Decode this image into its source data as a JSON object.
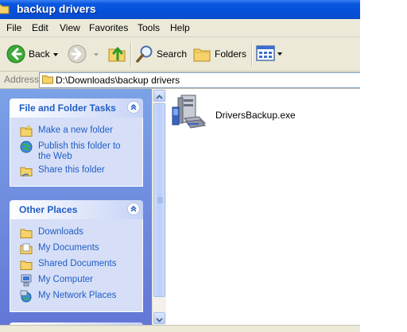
{
  "window": {
    "title": "backup drivers"
  },
  "menu": [
    "File",
    "Edit",
    "View",
    "Favorites",
    "Tools",
    "Help"
  ],
  "toolbar": {
    "back_label": "Back",
    "search_label": "Search",
    "folders_label": "Folders"
  },
  "address": {
    "label": "Address",
    "value": "D:\\Downloads\\backup drivers"
  },
  "tasks": {
    "title": "File and Folder Tasks",
    "items": [
      {
        "label": "Make a new folder",
        "icon": "new-folder-icon"
      },
      {
        "label": "Publish this folder to the Web",
        "line1": "Publish this folder to",
        "line2": "the Web",
        "icon": "globe-icon"
      },
      {
        "label": "Share this folder",
        "icon": "share-folder-icon"
      }
    ]
  },
  "places": {
    "title": "Other Places",
    "items": [
      {
        "label": "Downloads",
        "icon": "folder-icon"
      },
      {
        "label": "My Documents",
        "icon": "my-documents-icon"
      },
      {
        "label": "Shared Documents",
        "icon": "folder-icon"
      },
      {
        "label": "My Computer",
        "icon": "my-computer-icon"
      },
      {
        "label": "My Network Places",
        "icon": "network-places-icon"
      }
    ]
  },
  "files": [
    {
      "name": "DriversBackup.exe",
      "icon": "installer-icon"
    }
  ],
  "colors": {
    "titlebar": "#0A58E0",
    "link": "#215DC6",
    "taskpane": "#7BA2E7",
    "panel_body": "#D6DFF7"
  }
}
